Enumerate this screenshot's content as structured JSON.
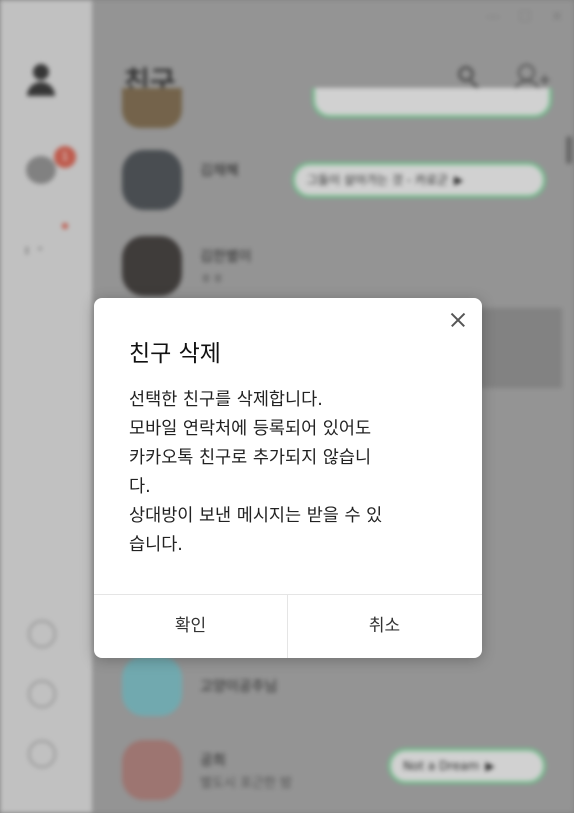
{
  "window": {
    "minimize_glyph": "—",
    "maximize_glyph": "☐",
    "close_glyph": "✕"
  },
  "sidebar": {
    "chat_badge": "1"
  },
  "header": {
    "title": "친구"
  },
  "friends": [
    {
      "name": "",
      "status": "",
      "avatar_color": "#7e6a4c",
      "music": ""
    },
    {
      "name": "김채혜",
      "status": "",
      "avatar_color": "#4a4f54",
      "music": "그들이 살아가는 것 - 카로군"
    },
    {
      "name": "김한별이",
      "status": "ㅎㅎ",
      "avatar_color": "#3e3a38",
      "music": ""
    },
    {
      "name": "고양이공주님",
      "status": "",
      "avatar_color": "#7bbfc6",
      "music": ""
    },
    {
      "name": "공희",
      "status": "별도시 포근한 밤",
      "avatar_color": "#b07f7a",
      "music": "Not a Dream"
    }
  ],
  "dialog": {
    "title": "친구 삭제",
    "message_lines": [
      "선택한 친구를 삭제합니다.",
      "모바일 연락처에 등록되어 있어도",
      "카카오톡 친구로 추가되지 않습니",
      "다.",
      "상대방이 보낸 메시지는 받을 수 있",
      "습니다."
    ],
    "confirm_label": "확인",
    "cancel_label": "취소"
  },
  "colors": {
    "accent_badge": "#d9604f",
    "music_border": "#7fd69c"
  }
}
